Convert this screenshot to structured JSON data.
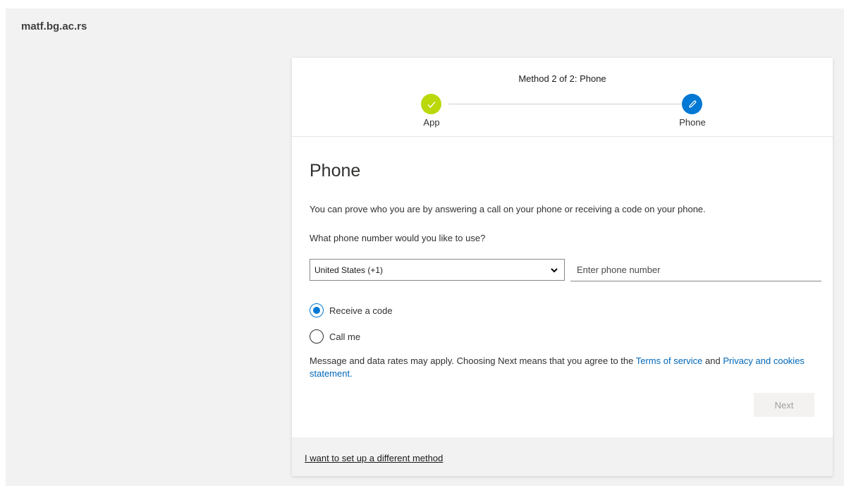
{
  "header": {
    "org_name": "matf.bg.ac.rs"
  },
  "progress": {
    "title": "Method 2 of 2: Phone",
    "steps": [
      {
        "label": "App",
        "status": "completed",
        "color": "#bad80a"
      },
      {
        "label": "Phone",
        "status": "current",
        "color": "#0078d4"
      }
    ]
  },
  "form": {
    "title": "Phone",
    "description": "You can prove who you are by answering a call on your phone or receiving a code on your phone.",
    "question": "What phone number would you like to use?",
    "country_selected": "United States (+1)",
    "phone_placeholder": "Enter phone number",
    "options": [
      {
        "label": "Receive a code",
        "checked": true
      },
      {
        "label": "Call me",
        "checked": false
      }
    ],
    "legal_prefix": "Message and data rates may apply. Choosing Next means that you agree to the ",
    "terms_link": "Terms of service",
    "legal_and": " and ",
    "privacy_link": "Privacy and cookies statement.",
    "next_label": "Next"
  },
  "footer": {
    "different_method_link": "I want to set up a different method"
  },
  "colors": {
    "accent": "#0078d4",
    "success": "#bad80a",
    "link": "#0067b8"
  }
}
